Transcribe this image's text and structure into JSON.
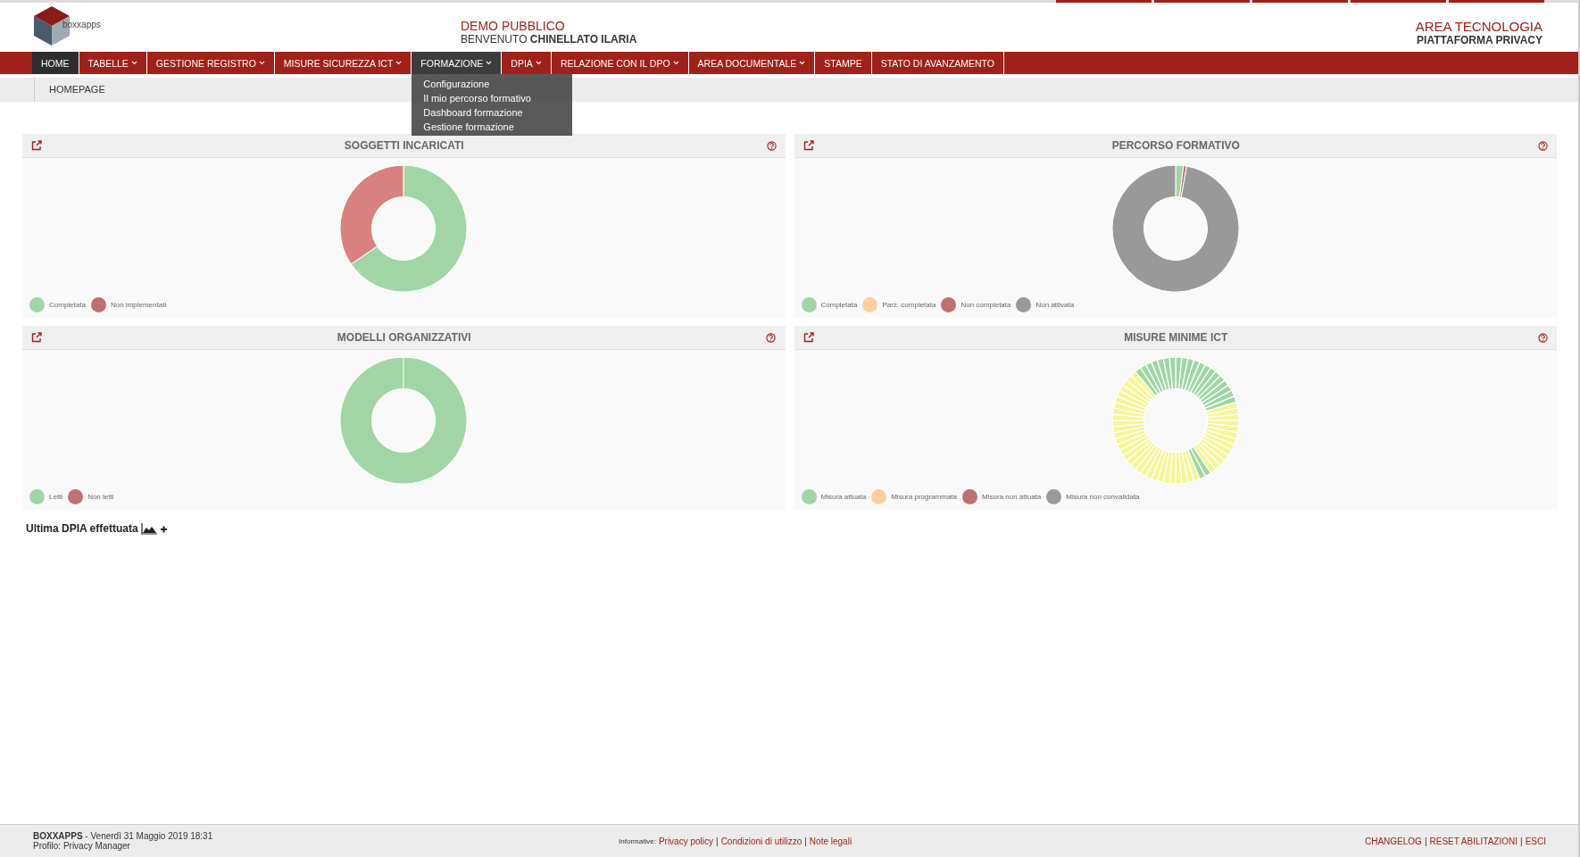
{
  "header": {
    "logo_text": "boxxapps",
    "center_title": "DEMO PUBBLICO",
    "welcome": "BENVENUTO",
    "user": "CHINELLATO ILARIA",
    "right_title": "AREA TECNOLOGIA",
    "right_subtitle": "PIATTAFORMA PRIVACY"
  },
  "nav": [
    {
      "label": "HOME",
      "selected": true,
      "dropdown": false
    },
    {
      "label": "TABELLE",
      "selected": false,
      "dropdown": true
    },
    {
      "label": "GESTIONE REGISTRO",
      "selected": false,
      "dropdown": true
    },
    {
      "label": "MISURE SICUREZZA ICT",
      "selected": false,
      "dropdown": true
    },
    {
      "label": "FORMAZIONE",
      "selected": false,
      "dropdown": true,
      "expanded": true,
      "menu": [
        "Configurazione",
        "Il mio percorso formativo",
        "Dashboard formazione",
        "Gestione formazione"
      ]
    },
    {
      "label": "DPIA",
      "selected": false,
      "dropdown": true
    },
    {
      "label": "RELAZIONE CON IL DPO",
      "selected": false,
      "dropdown": true
    },
    {
      "label": "AREA DOCUMENTALE",
      "selected": false,
      "dropdown": true
    },
    {
      "label": "STAMPE",
      "selected": false,
      "dropdown": false
    },
    {
      "label": "STATO DI AVANZAMENTO",
      "selected": false,
      "dropdown": false
    }
  ],
  "breadcrumb": "HOMEPAGE",
  "cards": [
    {
      "title": "SOGGETTI INCARICATI",
      "kind": "donut",
      "legend": [
        {
          "label": "Completata",
          "color": "#a1d5a5"
        },
        {
          "label": "Non implementati",
          "color": "#c07070"
        }
      ]
    },
    {
      "title": "PERCORSO FORMATIVO",
      "kind": "donut",
      "legend": [
        {
          "label": "Completata",
          "color": "#a1d5a5"
        },
        {
          "label": "Parz. completata",
          "color": "#fccf9f"
        },
        {
          "label": "Non completata",
          "color": "#c07070"
        },
        {
          "label": "Non attivata",
          "color": "#999999"
        }
      ]
    },
    {
      "title": "MODELLI ORGANIZZATIVI",
      "kind": "donut",
      "legend": [
        {
          "label": "Letti",
          "color": "#a1d5a5"
        },
        {
          "label": "Non letti",
          "color": "#c07070"
        }
      ]
    },
    {
      "title": "MISURE MINIME ICT",
      "kind": "segmented",
      "legend": [
        {
          "label": "Misura attuata",
          "color": "#a1d5a5"
        },
        {
          "label": "Misura programmata",
          "color": "#fccf9f"
        },
        {
          "label": "Misura non attuata",
          "color": "#c07070"
        },
        {
          "label": "Misura non convalidata",
          "color": "#999999"
        }
      ]
    }
  ],
  "dpia_label": "Ultima DPIA effettuata",
  "footer": {
    "brand": "BOXXAPPS",
    "date": " - Venerdì 31 Maggio 2019 18:31",
    "profile": "Profilo: Privacy Manager",
    "info_label": "Informative:",
    "separator": "|",
    "links": [
      "Privacy policy",
      "Condizioni di utilizzo",
      "Note legali"
    ],
    "right_links": [
      "CHANGELOG",
      "RESET ABILITAZIONI",
      "ESCI"
    ]
  }
}
